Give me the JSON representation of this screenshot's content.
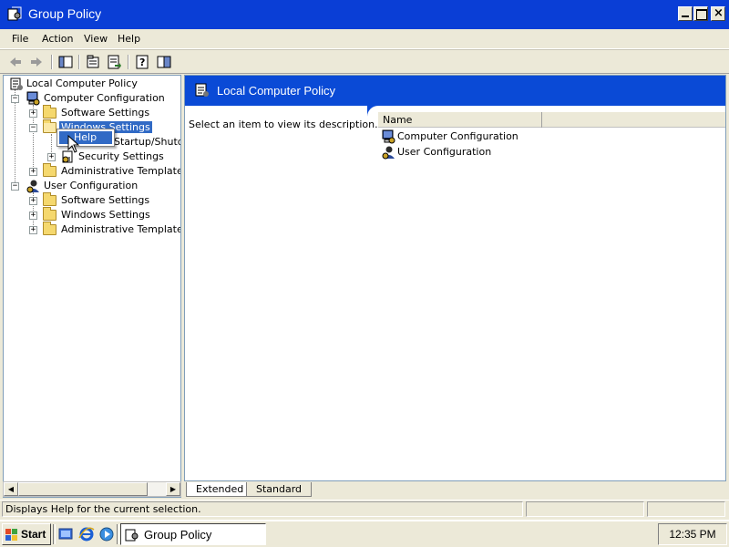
{
  "window": {
    "title": "Group Policy",
    "app_icon": "group-policy-icon"
  },
  "menu": {
    "items": [
      "File",
      "Action",
      "View",
      "Help"
    ]
  },
  "toolbar": {
    "buttons": [
      "back-arrow-icon",
      "forward-arrow-icon",
      "show-hide-tree-icon",
      "properties-icon",
      "export-list-icon",
      "help-icon",
      "show-hide-console-tree-icon"
    ]
  },
  "tree": {
    "root": "Local Computer Policy",
    "computer_config": "Computer Configuration",
    "software_settings_1": "Software Settings",
    "windows_settings_1": "Windows Settings",
    "scripts_partial": "Startup/Shutdo",
    "security_settings": "Security Settings",
    "admin_templates_1": "Administrative Templates",
    "user_config": "User Configuration",
    "software_settings_2": "Software Settings",
    "windows_settings_2": "Windows Settings",
    "admin_templates_2": "Administrative Templates"
  },
  "context_menu": {
    "item": "Help"
  },
  "right_pane": {
    "header": "Local Computer Policy",
    "description": "Select an item to view its description.",
    "column_name": "Name",
    "items": [
      "Computer Configuration",
      "User Configuration"
    ]
  },
  "tabs": {
    "extended": "Extended",
    "standard": "Standard"
  },
  "status": {
    "text": "Displays Help for the current selection."
  },
  "taskbar": {
    "start": "Start",
    "task": "Group Policy",
    "clock": "12:35 PM"
  },
  "colors": {
    "titlebar": "#0a3ed6",
    "selection": "#316ac5",
    "header_band": "#0a4ad6"
  }
}
